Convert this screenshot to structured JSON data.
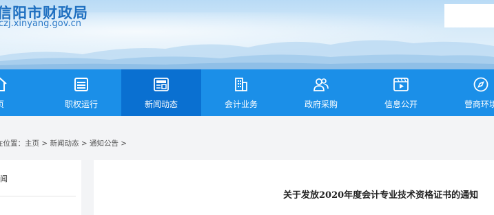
{
  "header": {
    "site_name": "信阳市财政局",
    "site_url": "czj.xinyang.gov.cn"
  },
  "nav": {
    "items": [
      {
        "label": "页",
        "icon": "home-icon"
      },
      {
        "label": "职权运行",
        "icon": "list-icon"
      },
      {
        "label": "新闻动态",
        "icon": "news-icon",
        "active": true
      },
      {
        "label": "会计业务",
        "icon": "building-icon"
      },
      {
        "label": "政府采购",
        "icon": "users-icon"
      },
      {
        "label": "信息公开",
        "icon": "video-icon"
      },
      {
        "label": "营商环境",
        "icon": "compass-icon"
      }
    ]
  },
  "breadcrumb": {
    "prefix": "在位置：",
    "home": "主页",
    "sep": " > ",
    "section": "新闻动态",
    "subsection": "通知公告",
    "tail": " >"
  },
  "sidebar": {
    "heading": "闻"
  },
  "article": {
    "title": "关于发放2020年度会计专业技术资格证书的通知"
  },
  "colors": {
    "nav_bg": "#1b8fe8",
    "nav_active": "#0a70d1",
    "brand_text": "#1e6fc0"
  }
}
